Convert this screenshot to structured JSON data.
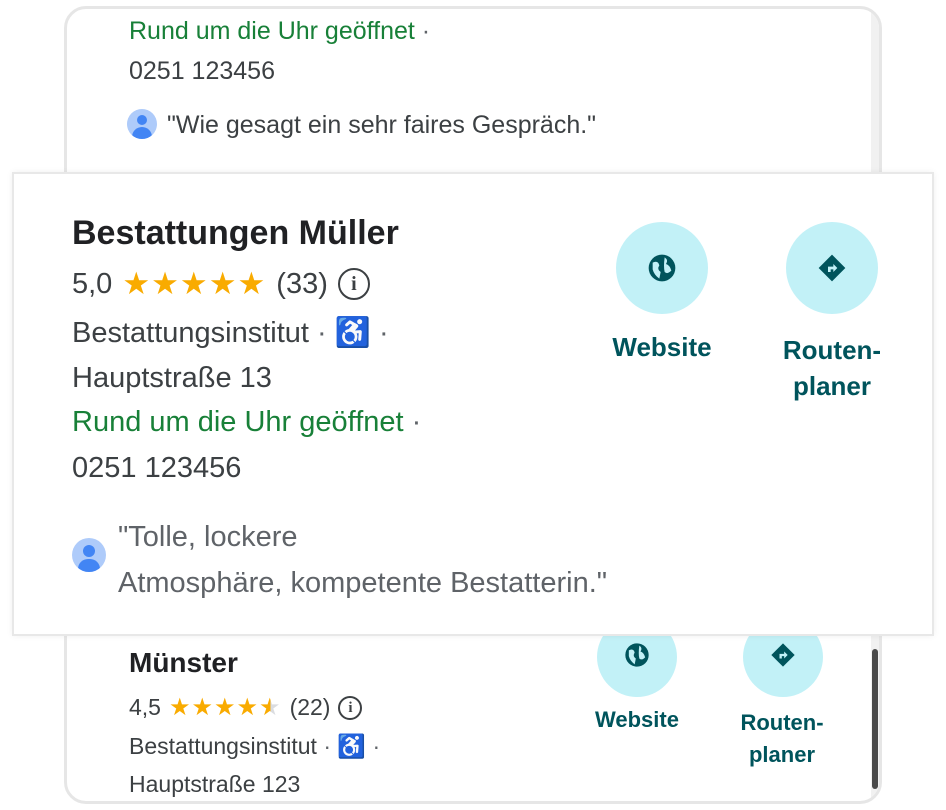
{
  "background_listing_top": {
    "hours": "Rund um die Uhr geöffnet",
    "separator": "·",
    "phone": "0251 123456",
    "review": "\"Wie gesagt ein sehr faires Gespräch.\""
  },
  "featured_listing": {
    "name": "Bestattungen Müller",
    "rating": "5,0",
    "stars": "★★★★★",
    "review_count": "(33)",
    "info_glyph": "i",
    "category": "Bestattungsinstitut",
    "separator": "·",
    "accessibility_glyph": "♿",
    "address": "Hauptstraße 13",
    "hours": "Rund um die Uhr geöffnet",
    "phone": "0251 123456",
    "review_line1": "\"Tolle, lockere",
    "review_line2": "Atmosphäre, kompetente Bestatterin.\"",
    "website_label": "Website",
    "route_label_line1": "Routen-",
    "route_label_line2": "planer"
  },
  "background_listing_bottom": {
    "name": "Münster",
    "rating": "4,5",
    "stars_full": "★★★★",
    "stars_half": "★",
    "stars_empty": "★",
    "review_count": "(22)",
    "info_glyph": "i",
    "category": "Bestattungsinstitut",
    "separator": "·",
    "accessibility_glyph": "♿",
    "address": "Hauptstraße 123",
    "website_label": "Website",
    "route_label_line1": "Routen-",
    "route_label_line2": "planer"
  },
  "colors": {
    "hours_green": "#188038",
    "star_gold": "#f9ab00",
    "action_bg": "#c2f1f7",
    "action_text": "#00545c",
    "accessibility_blue": "#1a73e8"
  }
}
